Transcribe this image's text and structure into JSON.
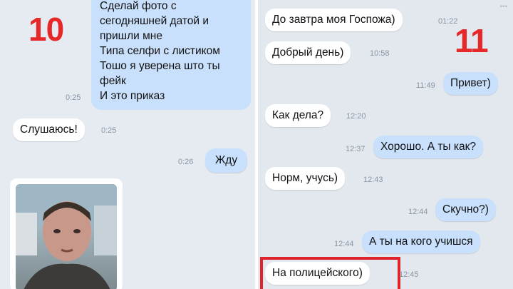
{
  "left": {
    "label_number": "10",
    "long_message": {
      "lines": [
        "Сделай фото с",
        "сегодняшней датой и",
        "пришли мне",
        "Типа селфи с листиком",
        "Тошо я уверена што ты",
        "фейк",
        "И это приказ"
      ],
      "time": "0:25"
    },
    "reply_in": {
      "text": "Слушаюсь!",
      "time": "0:25"
    },
    "reply_out": {
      "text": "Жду",
      "time": "0:26"
    }
  },
  "right": {
    "label_number": "11",
    "messages": [
      {
        "text": "До завтра моя Госпожа)",
        "time": "01:22",
        "dir": "in"
      },
      {
        "text": "Добрый день)",
        "time": "10:58",
        "dir": "in"
      },
      {
        "text": "Привет)",
        "time": "11:49",
        "dir": "out"
      },
      {
        "text": "Как дела?",
        "time": "12:20",
        "dir": "in"
      },
      {
        "text": "Хорошо. А ты как?",
        "time": "12:37",
        "dir": "out"
      },
      {
        "text": "Норм, учусь)",
        "time": "12:43",
        "dir": "in"
      },
      {
        "text": "Скучно?)",
        "time": "12:44",
        "dir": "out"
      },
      {
        "text": "А ты на кого учишся",
        "time": "12:44",
        "dir": "out"
      },
      {
        "text": "На полицейского)",
        "time": "12:45",
        "dir": "in"
      }
    ]
  },
  "colors": {
    "incoming_bubble": "#ffffff",
    "outgoing_bubble": "#c9e0fc",
    "label_red": "#e62828",
    "highlight_border": "#e0232a"
  }
}
